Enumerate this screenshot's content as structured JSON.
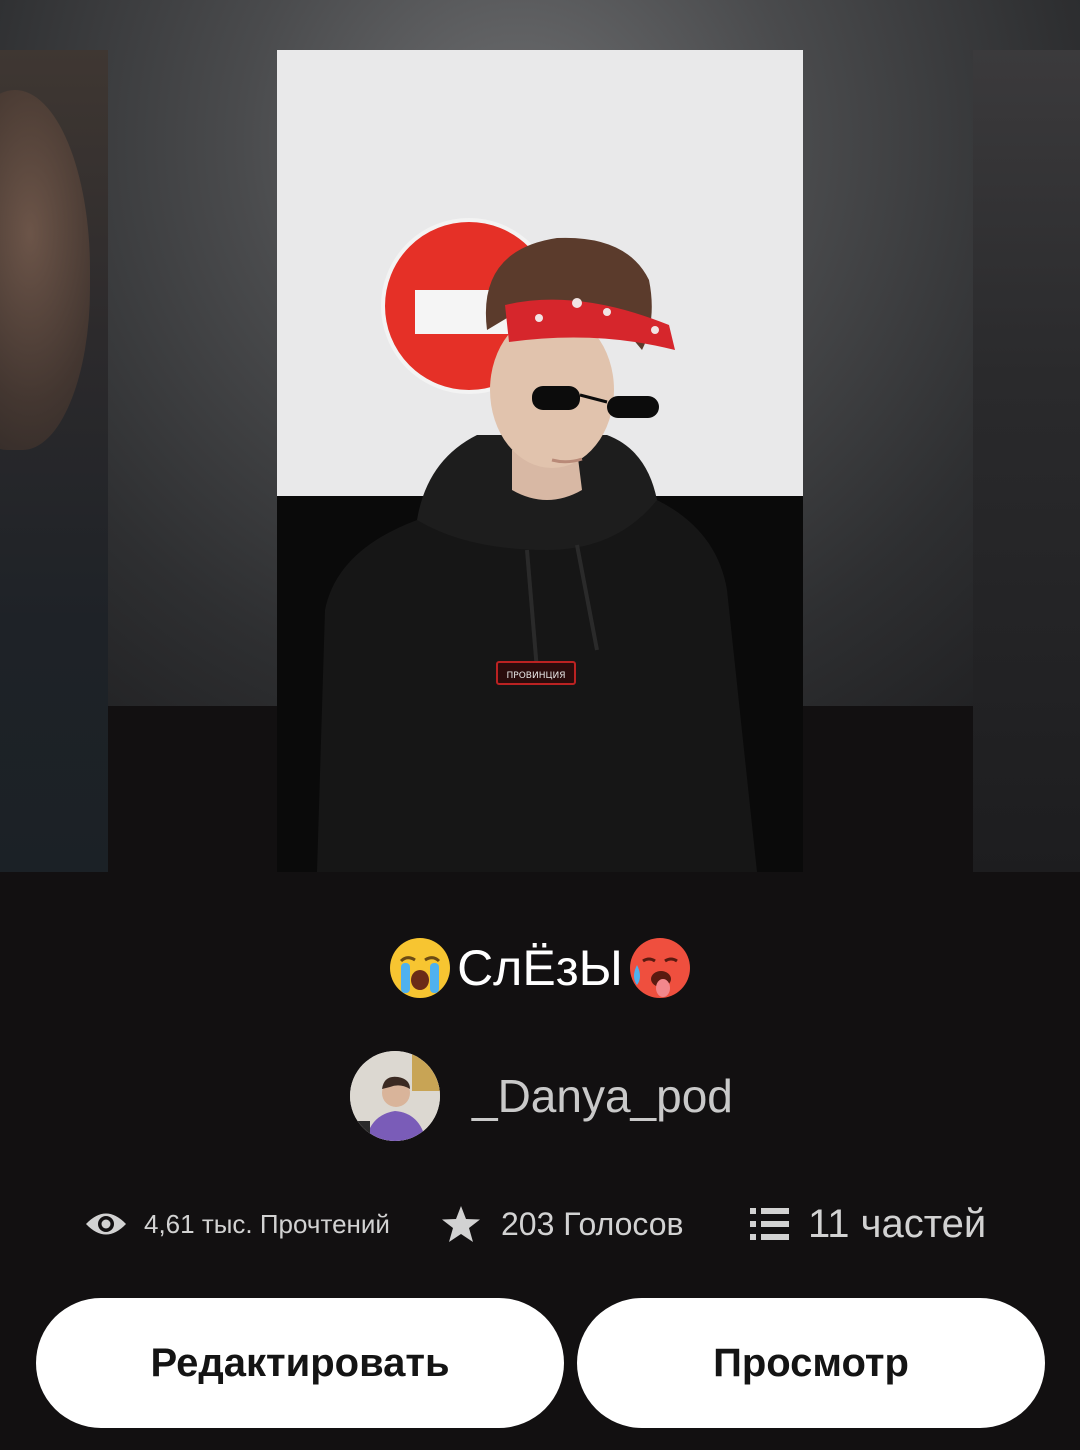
{
  "story": {
    "title": "СлЁзЫ",
    "title_emoji_left": "loudly-crying-face-emoji",
    "title_emoji_right": "hot-face-emoji",
    "cover_badge_text": "ПРОВИНЦИЯ"
  },
  "author": {
    "name": "_Danya_pod"
  },
  "stats": {
    "reads": "4,61 тыс. Прочтений",
    "reads_icon": "eye-icon",
    "votes": "203 Голосов",
    "votes_icon": "star-icon",
    "parts": "11 частей",
    "parts_icon": "list-icon"
  },
  "actions": {
    "edit_label": "Редактировать",
    "view_label": "Просмотр"
  },
  "colors": {
    "background": "#121011",
    "button_bg": "#ffffff",
    "button_text": "#141414",
    "stat_text": "#d2d2d2",
    "title_text": "#ffffff",
    "bandana_red": "#d6262c",
    "sign_red": "#e53027"
  }
}
